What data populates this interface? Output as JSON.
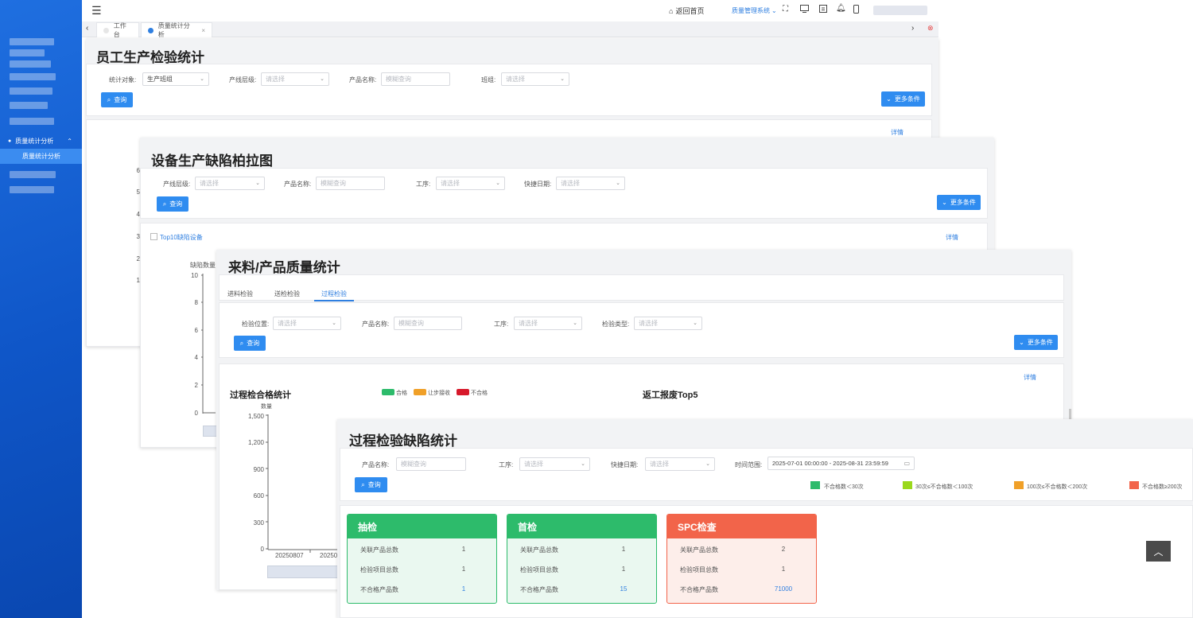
{
  "colors": {
    "sidebar": "#1565d8",
    "primary": "#2f8cf0",
    "green": "#2dbb6b",
    "orange": "#f0a028",
    "red": "#d7192b",
    "coral": "#f2644a",
    "lime": "#9ad81c"
  },
  "sidebar": {
    "section_label": "质量统计分析",
    "active_item": "质量统计分析"
  },
  "header": {
    "home_label": "返回首页",
    "system_label": "质量管理系统"
  },
  "tabs": [
    {
      "label": "工作台"
    },
    {
      "label": "质量统计分析"
    }
  ],
  "panel1": {
    "title": "员工生产检验统计",
    "filters": [
      {
        "label": "统计对象:",
        "value": "生产班组"
      },
      {
        "label": "产线层级:",
        "placeholder": "请选择"
      },
      {
        "label": "产品名称:",
        "placeholder": "模糊查询"
      },
      {
        "label": "班组:",
        "placeholder": "请选择"
      }
    ],
    "query_label": "查询",
    "more_label": "更多条件",
    "detail_label": "详情",
    "y_ticks": [
      "6",
      "5",
      "4",
      "3",
      "2",
      "1"
    ]
  },
  "panel2": {
    "title": "设备生产缺陷柏拉图",
    "filters": [
      {
        "label": "产线层级:",
        "placeholder": "请选择"
      },
      {
        "label": "产品名称:",
        "placeholder": "模糊查询"
      },
      {
        "label": "工序:",
        "placeholder": "请选择"
      },
      {
        "label": "快捷日期:",
        "placeholder": "请选择"
      }
    ],
    "query_label": "查询",
    "more_label": "更多条件",
    "top10_label": "Top10缺陷设备",
    "detail_label": "详情",
    "y_axis_title": "缺陷数量",
    "y_ticks": [
      "10",
      "8",
      "6",
      "4",
      "2",
      "0"
    ]
  },
  "panel3": {
    "title": "来料/产品质量统计",
    "tabs": [
      "进料检验",
      "送检检验",
      "过程检验"
    ],
    "active_tab": 2,
    "filters": [
      {
        "label": "检验位置:",
        "placeholder": "请选择"
      },
      {
        "label": "产品名称:",
        "placeholder": "模糊查询"
      },
      {
        "label": "工序:",
        "placeholder": "请选择"
      },
      {
        "label": "检验类型:",
        "placeholder": "请选择"
      }
    ],
    "query_label": "查询",
    "more_label": "更多条件",
    "detail_label": "详情",
    "chart_title": "过程检合格统计",
    "legend": [
      "合格",
      "让步接收",
      "不合格"
    ],
    "top5_title": "返工报废Top5",
    "y_axis_title": "数量",
    "y_ticks": [
      "1,500",
      "1,200",
      "900",
      "600",
      "300",
      "0"
    ],
    "x_ticks": [
      "20250807",
      "20250"
    ]
  },
  "panel4": {
    "title": "过程检验缺陷统计",
    "filters": [
      {
        "label": "产品名称:",
        "placeholder": "模糊查询"
      },
      {
        "label": "工序:",
        "placeholder": "请选择"
      },
      {
        "label": "快捷日期:",
        "placeholder": "请选择"
      },
      {
        "label": "时间范围:",
        "value": "2025-07-01 00:00:00 - 2025-08-31 23:59:59"
      }
    ],
    "query_label": "查询",
    "legend": [
      "不合格数＜30次",
      "30次≤不合格数＜100次",
      "100次≤不合格数＜200次",
      "不合格数≥200次"
    ],
    "cards": [
      {
        "title": "抽检",
        "rows": [
          {
            "k": "关联产品总数",
            "v": "1"
          },
          {
            "k": "检验项目总数",
            "v": "1"
          },
          {
            "k": "不合格产品数",
            "v": "1"
          }
        ]
      },
      {
        "title": "首检",
        "rows": [
          {
            "k": "关联产品总数",
            "v": "1"
          },
          {
            "k": "检验项目总数",
            "v": "1"
          },
          {
            "k": "不合格产品数",
            "v": "15"
          }
        ]
      },
      {
        "title": "SPC检查",
        "rows": [
          {
            "k": "关联产品总数",
            "v": "2"
          },
          {
            "k": "检验项目总数",
            "v": "1"
          },
          {
            "k": "不合格产品数",
            "v": "71000"
          }
        ]
      }
    ]
  }
}
